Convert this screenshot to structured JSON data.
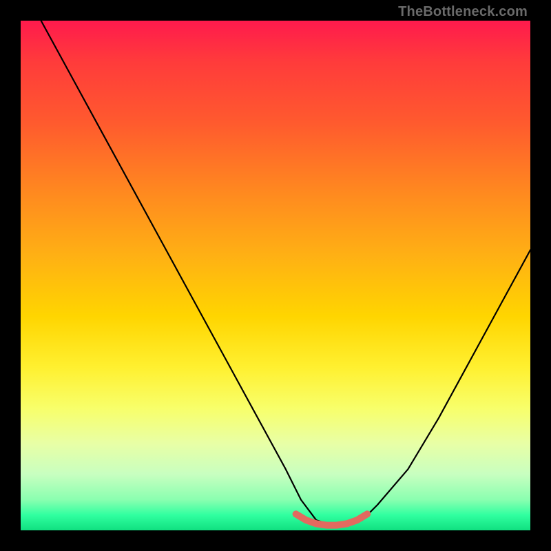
{
  "watermark": "TheBottleneck.com",
  "chart_data": {
    "type": "line",
    "title": "",
    "xlabel": "",
    "ylabel": "",
    "xlim": [
      0,
      100
    ],
    "ylim": [
      0,
      100
    ],
    "series": [
      {
        "name": "bottleneck-curve",
        "color": "#000000",
        "x": [
          4,
          10,
          16,
          22,
          28,
          34,
          40,
          46,
          52,
          55,
          58,
          61,
          64,
          67,
          70,
          76,
          82,
          88,
          94,
          100
        ],
        "values": [
          100,
          89,
          78,
          67,
          56,
          45,
          34,
          23,
          12,
          6,
          2,
          1,
          1,
          2,
          5,
          12,
          22,
          33,
          44,
          55
        ]
      },
      {
        "name": "optimal-band",
        "color": "#e26a5f",
        "x": [
          54,
          56,
          58,
          60,
          62,
          64,
          66,
          68
        ],
        "values": [
          3.2,
          2.0,
          1.3,
          1.0,
          1.0,
          1.3,
          2.0,
          3.2
        ]
      }
    ],
    "gradient_stops": [
      {
        "pos": 0,
        "color": "#ff1a4d"
      },
      {
        "pos": 50,
        "color": "#ffd500"
      },
      {
        "pos": 85,
        "color": "#e8ffa6"
      },
      {
        "pos": 100,
        "color": "#10e080"
      }
    ]
  }
}
